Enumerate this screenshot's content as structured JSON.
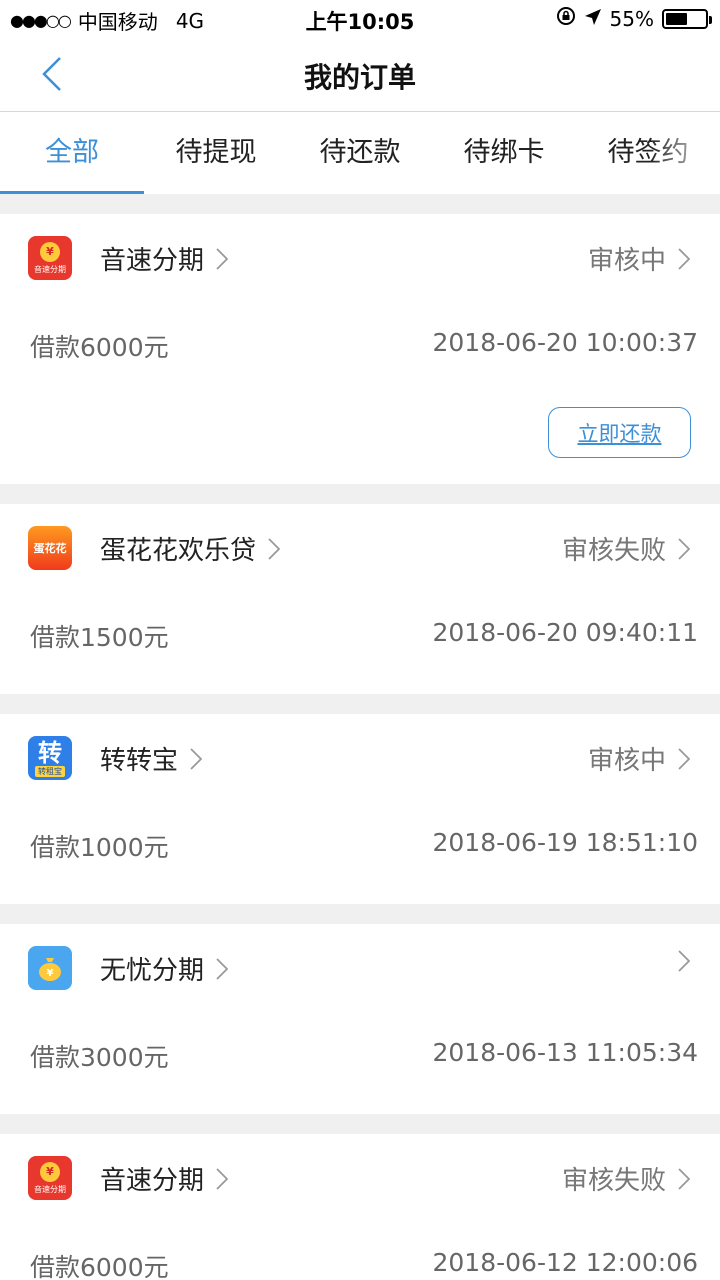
{
  "status_bar": {
    "carrier": "中国移动",
    "network": "4G",
    "time": "上午10:05",
    "battery_percent": "55%",
    "battery_level": 0.55
  },
  "nav": {
    "title": "我的订单",
    "back_icon": "chevron-left-icon"
  },
  "tabs": [
    {
      "label": "全部",
      "active": true
    },
    {
      "label": "待提现",
      "active": false
    },
    {
      "label": "待还款",
      "active": false
    },
    {
      "label": "待绑卡",
      "active": false
    },
    {
      "label": "待签约",
      "active": false
    }
  ],
  "orders": [
    {
      "app_name": "音速分期",
      "status": "审核中",
      "amount": "借款6000元",
      "datetime": "2018-06-20 10:00:37",
      "action_label": "立即还款",
      "icon_text": "音速分期"
    },
    {
      "app_name": "蛋花花欢乐贷",
      "status": "审核失败",
      "amount": "借款1500元",
      "datetime": "2018-06-20 09:40:11",
      "icon_text": "蛋花花"
    },
    {
      "app_name": "转转宝",
      "status": "审核中",
      "amount": "借款1000元",
      "datetime": "2018-06-19 18:51:10",
      "icon_text": "转",
      "icon_subtext": "转租宝"
    },
    {
      "app_name": "无忧分期",
      "status": "",
      "amount": "借款3000元",
      "datetime": "2018-06-13 11:05:34"
    },
    {
      "app_name": "音速分期",
      "status": "审核失败",
      "amount": "借款6000元",
      "datetime": "2018-06-12 12:00:06",
      "icon_text": "音速分期"
    }
  ],
  "colors": {
    "accent": "#3d8fd7",
    "page_bg": "#f0f0f0"
  }
}
